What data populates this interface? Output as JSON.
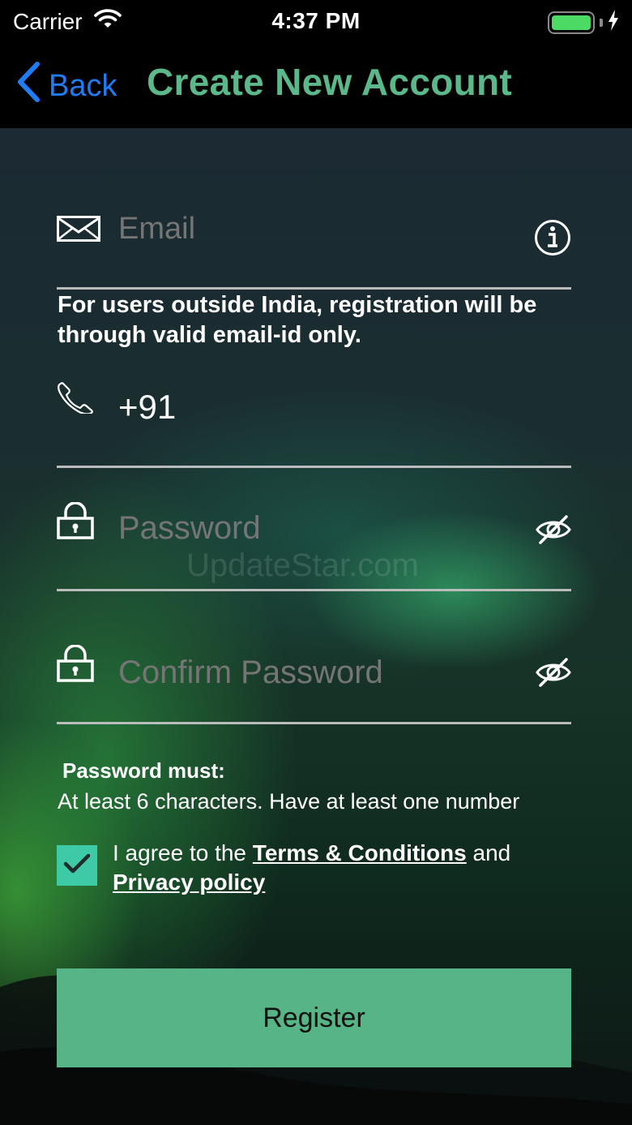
{
  "status_bar": {
    "carrier": "Carrier",
    "time": "4:37 PM",
    "battery_level": 1.0
  },
  "nav": {
    "back_label": "Back",
    "title": "Create New Account"
  },
  "form": {
    "email": {
      "placeholder": "Email"
    },
    "note": "For users outside India, registration will be through valid email-id only.",
    "phone": {
      "value": "+91"
    },
    "password": {
      "placeholder": "Password"
    },
    "confirm_password": {
      "placeholder": "Confirm Password"
    },
    "watermark": "UpdateStar.com",
    "rules_title": "Password must:",
    "rules_text": "At least 6 characters. Have at least one number",
    "agree": {
      "checked": true,
      "prefix": "I agree to the",
      "terms_label": "Terms & Conditions",
      "conjunction": "and",
      "privacy_label": "Privacy policy"
    },
    "register_label": "Register"
  },
  "colors": {
    "title_green": "#5ab88a",
    "back_blue": "#1f7cf2",
    "checkbox": "#3ec9a7",
    "button": "#56b487"
  },
  "icons": [
    "wifi-icon",
    "battery-icon",
    "charging-bolt-icon",
    "back-chevron-icon",
    "envelope-icon",
    "info-icon",
    "phone-icon",
    "lock-icon",
    "eye-slash-icon",
    "checkmark-icon"
  ]
}
